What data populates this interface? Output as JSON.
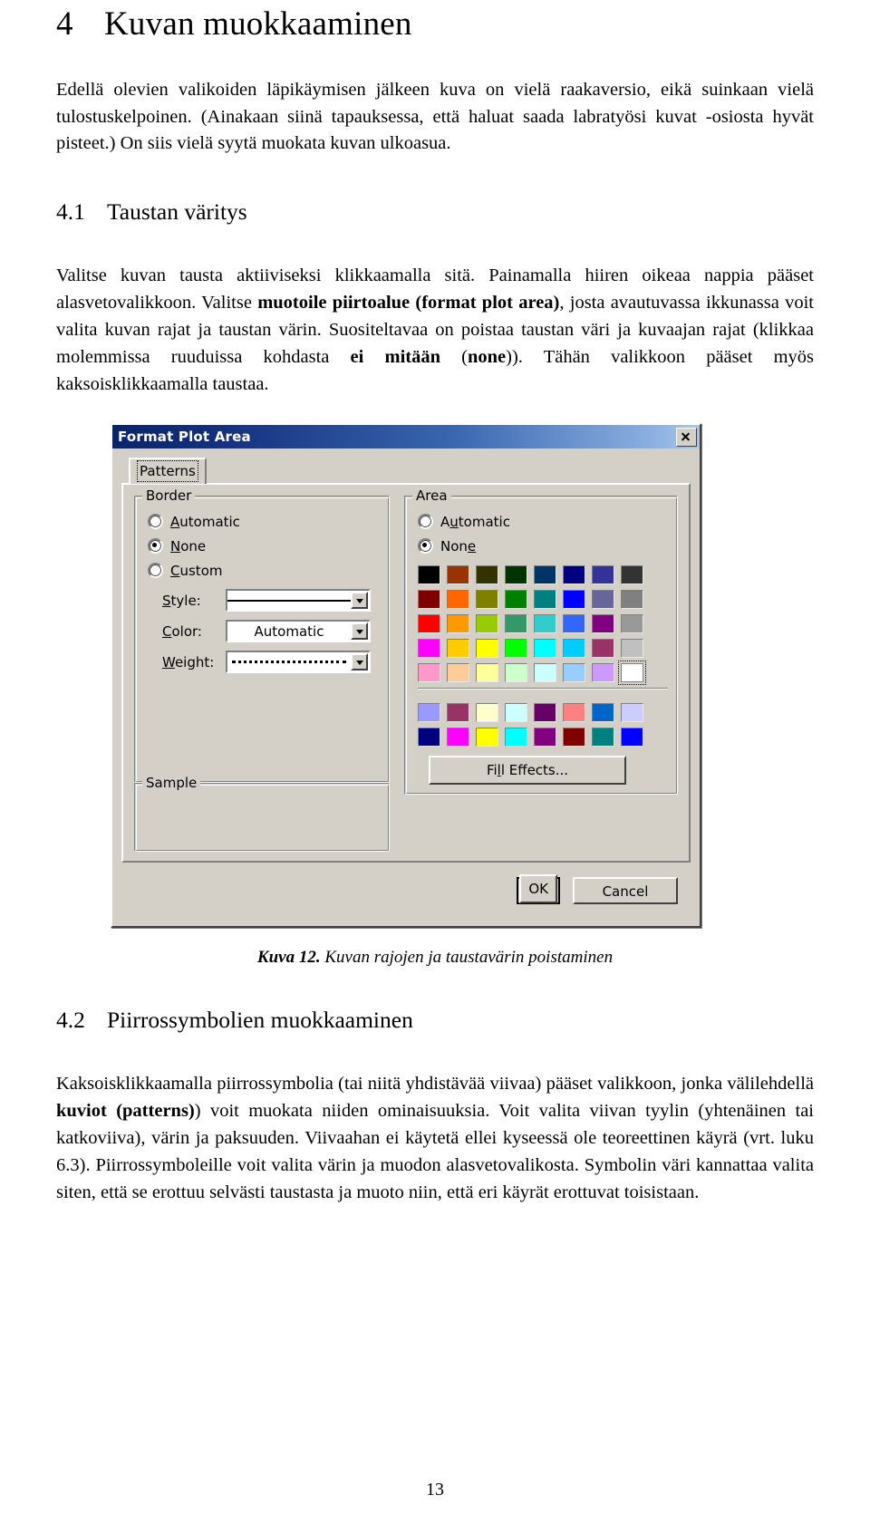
{
  "document": {
    "chapter": {
      "number": "4",
      "title": "Kuvan muokkaaminen"
    },
    "intro_paragraph": "Edellä olevien valikoiden läpikäymisen jälkeen kuva on vielä raakaversio, eikä suinkaan vielä tulostuskelpoinen. (Ainakaan siinä tapauksessa, että haluat saada labratyösi kuvat -osiosta hyvät pisteet.) On siis vielä syytä muokata kuvan ulkoasua.",
    "section_41": {
      "number": "4.1",
      "title": "Taustan väritys",
      "paragraph_parts": [
        {
          "text": "Valitse kuvan tausta aktiiviseksi klikkaamalla sitä. Painamalla hiiren oikeaa nappia pääset alasvetovalikkoon. Valitse ",
          "bold": false
        },
        {
          "text": "muotoile piirtoalue (format plot area)",
          "bold": true
        },
        {
          "text": ", josta avautuvassa ikkunassa voit valita kuvan rajat ja taustan värin. Suositeltavaa on poistaa taustan väri ja kuvaajan rajat (klikkaa molemmissa ruuduissa kohdasta ",
          "bold": false
        },
        {
          "text": "ei mitään",
          "bold": true
        },
        {
          "text": " (",
          "bold": false
        },
        {
          "text": "none",
          "bold": true
        },
        {
          "text": ")). Tähän valikkoon pääset myös kaksoisklikkaamalla taustaa.",
          "bold": false
        }
      ]
    },
    "figure_caption": {
      "label": "Kuva 12.",
      "text": " Kuvan rajojen ja taustavärin poistaminen"
    },
    "section_42": {
      "number": "4.2",
      "title": "Piirrossymbolien muokkaaminen",
      "paragraph_parts": [
        {
          "text": "Kaksoisklikkaamalla piirrossymbolia (tai niitä yhdistävää viivaa) pääset valikkoon, jonka välilehdellä ",
          "bold": false
        },
        {
          "text": "kuviot (patterns)",
          "bold": true
        },
        {
          "text": ") voit muokata niiden ominaisuuksia. Voit valita viivan tyylin (yhtenäinen tai katkoviiva), värin ja paksuuden. Viivaahan ei käytetä ellei kyseessä ole teoreettinen käyrä (vrt. luku 6.3). Piirrossymboleille voit valita värin ja muodon alasvetovalikosta. Symbolin väri kannattaa valita siten, että se erottuu selvästi taustasta ja muoto niin, että eri käyrät erottuvat toisistaan.",
          "bold": false
        }
      ]
    },
    "page_number": "13"
  },
  "dialog": {
    "title": "Format Plot Area",
    "close_label": "×",
    "tabs": [
      {
        "label": "Patterns",
        "active": true
      }
    ],
    "border_group": {
      "legend": "Border",
      "radios": [
        {
          "label": "Automatic",
          "accel": "A",
          "selected": false
        },
        {
          "label": "None",
          "accel": "N",
          "selected": true
        },
        {
          "label": "Custom",
          "accel": "C",
          "selected": false
        }
      ],
      "fields": [
        {
          "label": "Style:",
          "accel": "S",
          "value": "",
          "render": "solid-line"
        },
        {
          "label": "Color:",
          "accel": "C",
          "value": "Automatic",
          "render": "text"
        },
        {
          "label": "Weight:",
          "accel": "W",
          "value": "",
          "render": "dotted-line"
        }
      ]
    },
    "sample_group": {
      "legend": "Sample"
    },
    "area_group": {
      "legend": "Area",
      "radios": [
        {
          "label": "Automatic",
          "accel": "u",
          "selected": false
        },
        {
          "label": "None",
          "accel": "e",
          "selected": true
        }
      ],
      "palette_rows": [
        [
          "#000000",
          "#993300",
          "#333300",
          "#003300",
          "#003366",
          "#000080",
          "#333399",
          "#333333"
        ],
        [
          "#800000",
          "#ff6600",
          "#808000",
          "#008000",
          "#008080",
          "#0000ff",
          "#666699",
          "#808080"
        ],
        [
          "#ff0000",
          "#ff9900",
          "#99cc00",
          "#339966",
          "#33cccc",
          "#3366ff",
          "#800080",
          "#999999"
        ],
        [
          "#ff00ff",
          "#ffcc00",
          "#ffff00",
          "#00ff00",
          "#00ffff",
          "#00ccff",
          "#993366",
          "#c0c0c0"
        ],
        [
          "#ff99cc",
          "#ffcc99",
          "#ffff99",
          "#ccffcc",
          "#ccffff",
          "#99ccff",
          "#cc99ff",
          "#ffffff"
        ]
      ],
      "palette_selected": {
        "row": 4,
        "col": 7,
        "color": "#ffffff"
      },
      "custom_rows": [
        [
          "#9999ff",
          "#993366",
          "#ffffcc",
          "#ccffff",
          "#660066",
          "#ff8080",
          "#0066cc",
          "#ccccff"
        ],
        [
          "#000080",
          "#ff00ff",
          "#ffff00",
          "#00ffff",
          "#800080",
          "#800000",
          "#008080",
          "#0000ff"
        ]
      ],
      "fill_effects_label": "Fill Effects...",
      "fill_effects_accel": "l"
    },
    "buttons": [
      {
        "label": "OK",
        "default": true
      },
      {
        "label": "Cancel",
        "default": false
      }
    ]
  }
}
